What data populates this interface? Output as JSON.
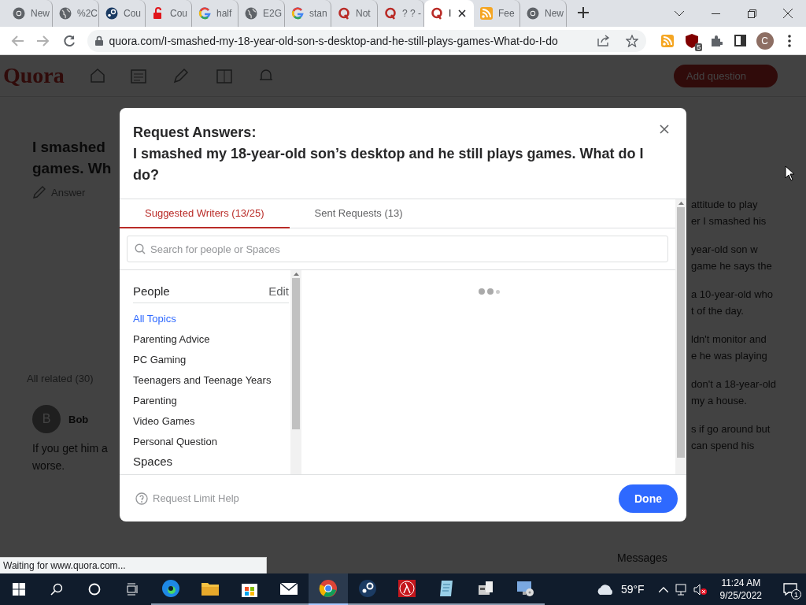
{
  "browser": {
    "tabs": [
      {
        "kind": "chrome",
        "title": "New",
        "selected": false
      },
      {
        "kind": "globe",
        "title": "%2C",
        "selected": false
      },
      {
        "kind": "steam",
        "title": "Cou",
        "selected": false
      },
      {
        "kind": "lock",
        "title": "Cou",
        "selected": false
      },
      {
        "kind": "google",
        "title": "half",
        "selected": false
      },
      {
        "kind": "globe",
        "title": "E2G",
        "selected": false
      },
      {
        "kind": "google",
        "title": "stan",
        "selected": false
      },
      {
        "kind": "quora",
        "title": "Not",
        "selected": false
      },
      {
        "kind": "quora",
        "title": "? ? -",
        "selected": false
      },
      {
        "kind": "quora",
        "title": "I",
        "selected": true
      },
      {
        "kind": "rss",
        "title": "Fee",
        "selected": false
      },
      {
        "kind": "chrome",
        "title": "New",
        "selected": false
      }
    ],
    "url": "quora.com/I-smashed-my-18-year-old-son-s-desktop-and-he-still-plays-games-What-do-I-do",
    "extension_badge": "5",
    "profile_initial": "C",
    "status": "Waiting for www.quora.com..."
  },
  "page": {
    "logo": "Quora",
    "add_question": "Add question",
    "question_lines": [
      "I smashed",
      "games. Wh"
    ],
    "answer": "Answer",
    "related": "All related (30)",
    "author": "Bob",
    "author_initial": "B",
    "answer_lines": [
      "If you get him a",
      "worse."
    ],
    "messages": "Messages",
    "side_lines": [
      "attitude to play",
      "er I smashed his",
      "year-old son w",
      "game he says the",
      "a 10-year-old who",
      "t of the day.",
      "ldn't monitor and",
      "e he was playing",
      "don't a 18-year-old",
      "my a house.",
      "s if go around but",
      "can spend his"
    ]
  },
  "modal": {
    "title": "Request Answers:",
    "question": "I smashed my 18-year-old son’s desktop and he still plays games. What do I do?",
    "tabs": [
      {
        "label": "Suggested Writers (13/25)",
        "selected": true
      },
      {
        "label": "Sent Requests (13)",
        "selected": false
      }
    ],
    "search": {
      "placeholder": "Search for people or Spaces"
    },
    "people_heading": "People",
    "edit": "Edit",
    "topics": [
      {
        "label": "All Topics",
        "selected": true
      },
      {
        "label": "Parenting Advice",
        "selected": false
      },
      {
        "label": "PC Gaming",
        "selected": false
      },
      {
        "label": "Teenagers and Teenage Years",
        "selected": false
      },
      {
        "label": "Parenting",
        "selected": false
      },
      {
        "label": "Video Games",
        "selected": false
      },
      {
        "label": "Personal Question",
        "selected": false
      }
    ],
    "spaces_heading": "Spaces",
    "help": "Request Limit Help",
    "done": "Done"
  },
  "taskbar": {
    "apps": [
      {
        "kind": "edge",
        "selected": false
      },
      {
        "kind": "folder",
        "selected": false
      },
      {
        "kind": "store",
        "selected": false
      },
      {
        "kind": "mail",
        "selected": false
      },
      {
        "kind": "chrome",
        "selected": true
      },
      {
        "kind": "steam",
        "selected": false
      },
      {
        "kind": "redapp",
        "selected": false
      },
      {
        "kind": "notepad",
        "selected": false
      },
      {
        "kind": "devices",
        "selected": false
      },
      {
        "kind": "monitor",
        "selected": false
      }
    ],
    "temperature": "59°F",
    "time": "11:24 AM",
    "date": "9/25/2022",
    "notifications": "1"
  }
}
